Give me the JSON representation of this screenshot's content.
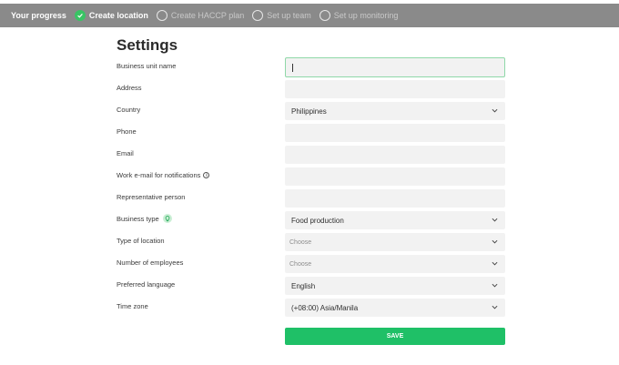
{
  "progress": {
    "title": "Your progress",
    "steps": [
      {
        "label": "Create location",
        "state": "active"
      },
      {
        "label": "Create HACCP plan",
        "state": "pending"
      },
      {
        "label": "Set up team",
        "state": "pending"
      },
      {
        "label": "Set up monitoring",
        "state": "pending"
      }
    ]
  },
  "page_title": "Settings",
  "fields": {
    "business_unit_name": {
      "label": "Business unit name",
      "value": ""
    },
    "address": {
      "label": "Address",
      "value": ""
    },
    "country": {
      "label": "Country",
      "value": "Philippines"
    },
    "phone": {
      "label": "Phone",
      "value": ""
    },
    "email": {
      "label": "Email",
      "value": ""
    },
    "work_email": {
      "label": "Work e-mail for notifications",
      "value": ""
    },
    "representative": {
      "label": "Representative person",
      "value": ""
    },
    "business_type": {
      "label": "Business type",
      "value": "Food production"
    },
    "type_of_location": {
      "label": "Type of location",
      "value": "Choose"
    },
    "number_of_employees": {
      "label": "Number of employees",
      "value": "Choose"
    },
    "preferred_language": {
      "label": "Preferred language",
      "value": "English"
    },
    "time_zone": {
      "label": "Time zone",
      "value": "(+08:00) Asia/Manila"
    }
  },
  "save_label": "SAVE",
  "colors": {
    "accent": "#1fc067",
    "header_bg": "#8a8a8a",
    "field_bg": "#f2f2f2"
  }
}
